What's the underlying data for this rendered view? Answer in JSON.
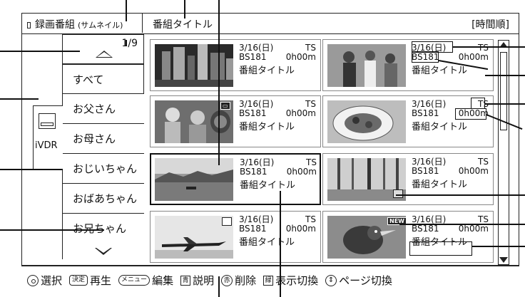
{
  "header": {
    "section": "録画番組",
    "section_sub": "(サムネイル)",
    "program_title": "番組タイトル",
    "sort_order": "[時間順]"
  },
  "device": {
    "label": "iVDR",
    "icon": "disk-icon"
  },
  "pager": {
    "page": "1/9"
  },
  "categories": [
    "すべて",
    "お父さん",
    "お母さん",
    "おじいちゃん",
    "おばあちゃん",
    "お兄ちゃん"
  ],
  "programs": [
    {
      "date": "3/16(日)",
      "format": "TS",
      "channel": "BS181",
      "duration": "0h00m",
      "title": "番組タイトル",
      "scene": "city-at-night"
    },
    {
      "date": "3/16(日)",
      "format": "TS",
      "channel": "BS181",
      "duration": "0h00m",
      "title": "番組タイトル",
      "scene": "crowd"
    },
    {
      "date": "3/16(日)",
      "format": "TS",
      "channel": "BS181",
      "duration": "0h00m",
      "title": "番組タイトル",
      "scene": "people-in-hats"
    },
    {
      "date": "3/16(日)",
      "format": "TS",
      "channel": "BS181",
      "duration": "0h00m",
      "title": "番組タイトル",
      "scene": "dish-of-food"
    },
    {
      "date": "3/16(日)",
      "format": "TS",
      "channel": "BS181",
      "duration": "0h00m",
      "title": "番組タイトル",
      "scene": "harbor-landscape"
    },
    {
      "date": "3/16(日)",
      "format": "TS",
      "channel": "BS181",
      "duration": "0h00m",
      "title": "番組タイトル",
      "scene": "forest"
    },
    {
      "date": "3/16(日)",
      "format": "TS",
      "channel": "BS181",
      "duration": "0h00m",
      "title": "番組タイトル",
      "scene": "airplane"
    },
    {
      "date": "3/16(日)",
      "format": "TS",
      "channel": "BS181",
      "duration": "0h00m",
      "title": "番組タイトル",
      "scene": "bird"
    }
  ],
  "badges": {
    "new": "NEW"
  },
  "footer": {
    "select_label": "選択",
    "play_key": "決定",
    "play_label": "再生",
    "edit_key": "メニュー",
    "edit_label": "編集",
    "info_key": "青",
    "info_label": "説明",
    "delete_key": "赤",
    "delete_label": "削除",
    "view_key": "緑",
    "view_label": "表示切換",
    "page_label": "ページ切換"
  }
}
